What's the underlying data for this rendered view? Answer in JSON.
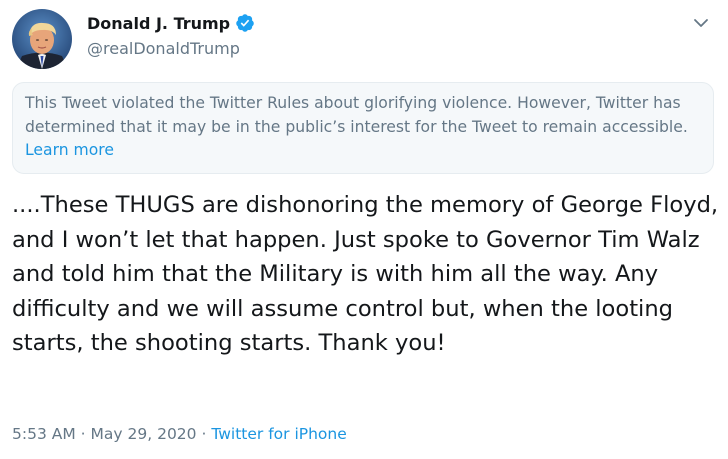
{
  "author": {
    "display_name": "Donald J. Trump",
    "handle": "@realDonaldTrump",
    "verified": true,
    "verified_icon": "verified-badge-icon",
    "avatar_icon": "profile-photo"
  },
  "menu": {
    "icon": "chevron-down-icon"
  },
  "notice": {
    "text": "This Tweet violated the Twitter Rules about glorifying violence. However, Twitter has determined that it may be in the public’s interest for the Tweet to remain accessible.",
    "link_label": "Learn more"
  },
  "tweet": {
    "text": "....These THUGS are dishonoring the memory of George Floyd, and I won’t let that happen. Just spoke to Governor Tim Walz and told him that the Military is with him all the way. Any difficulty and we will assume control but, when the looting starts, the shooting starts. Thank you!"
  },
  "meta": {
    "time": "5:53 AM",
    "separator": "·",
    "date": "May 29, 2020",
    "source": "Twitter for iPhone"
  },
  "colors": {
    "accent": "#1b95e0",
    "verified": "#1da1f2",
    "secondary_text": "#657786",
    "notice_bg": "#f5f8fa"
  }
}
